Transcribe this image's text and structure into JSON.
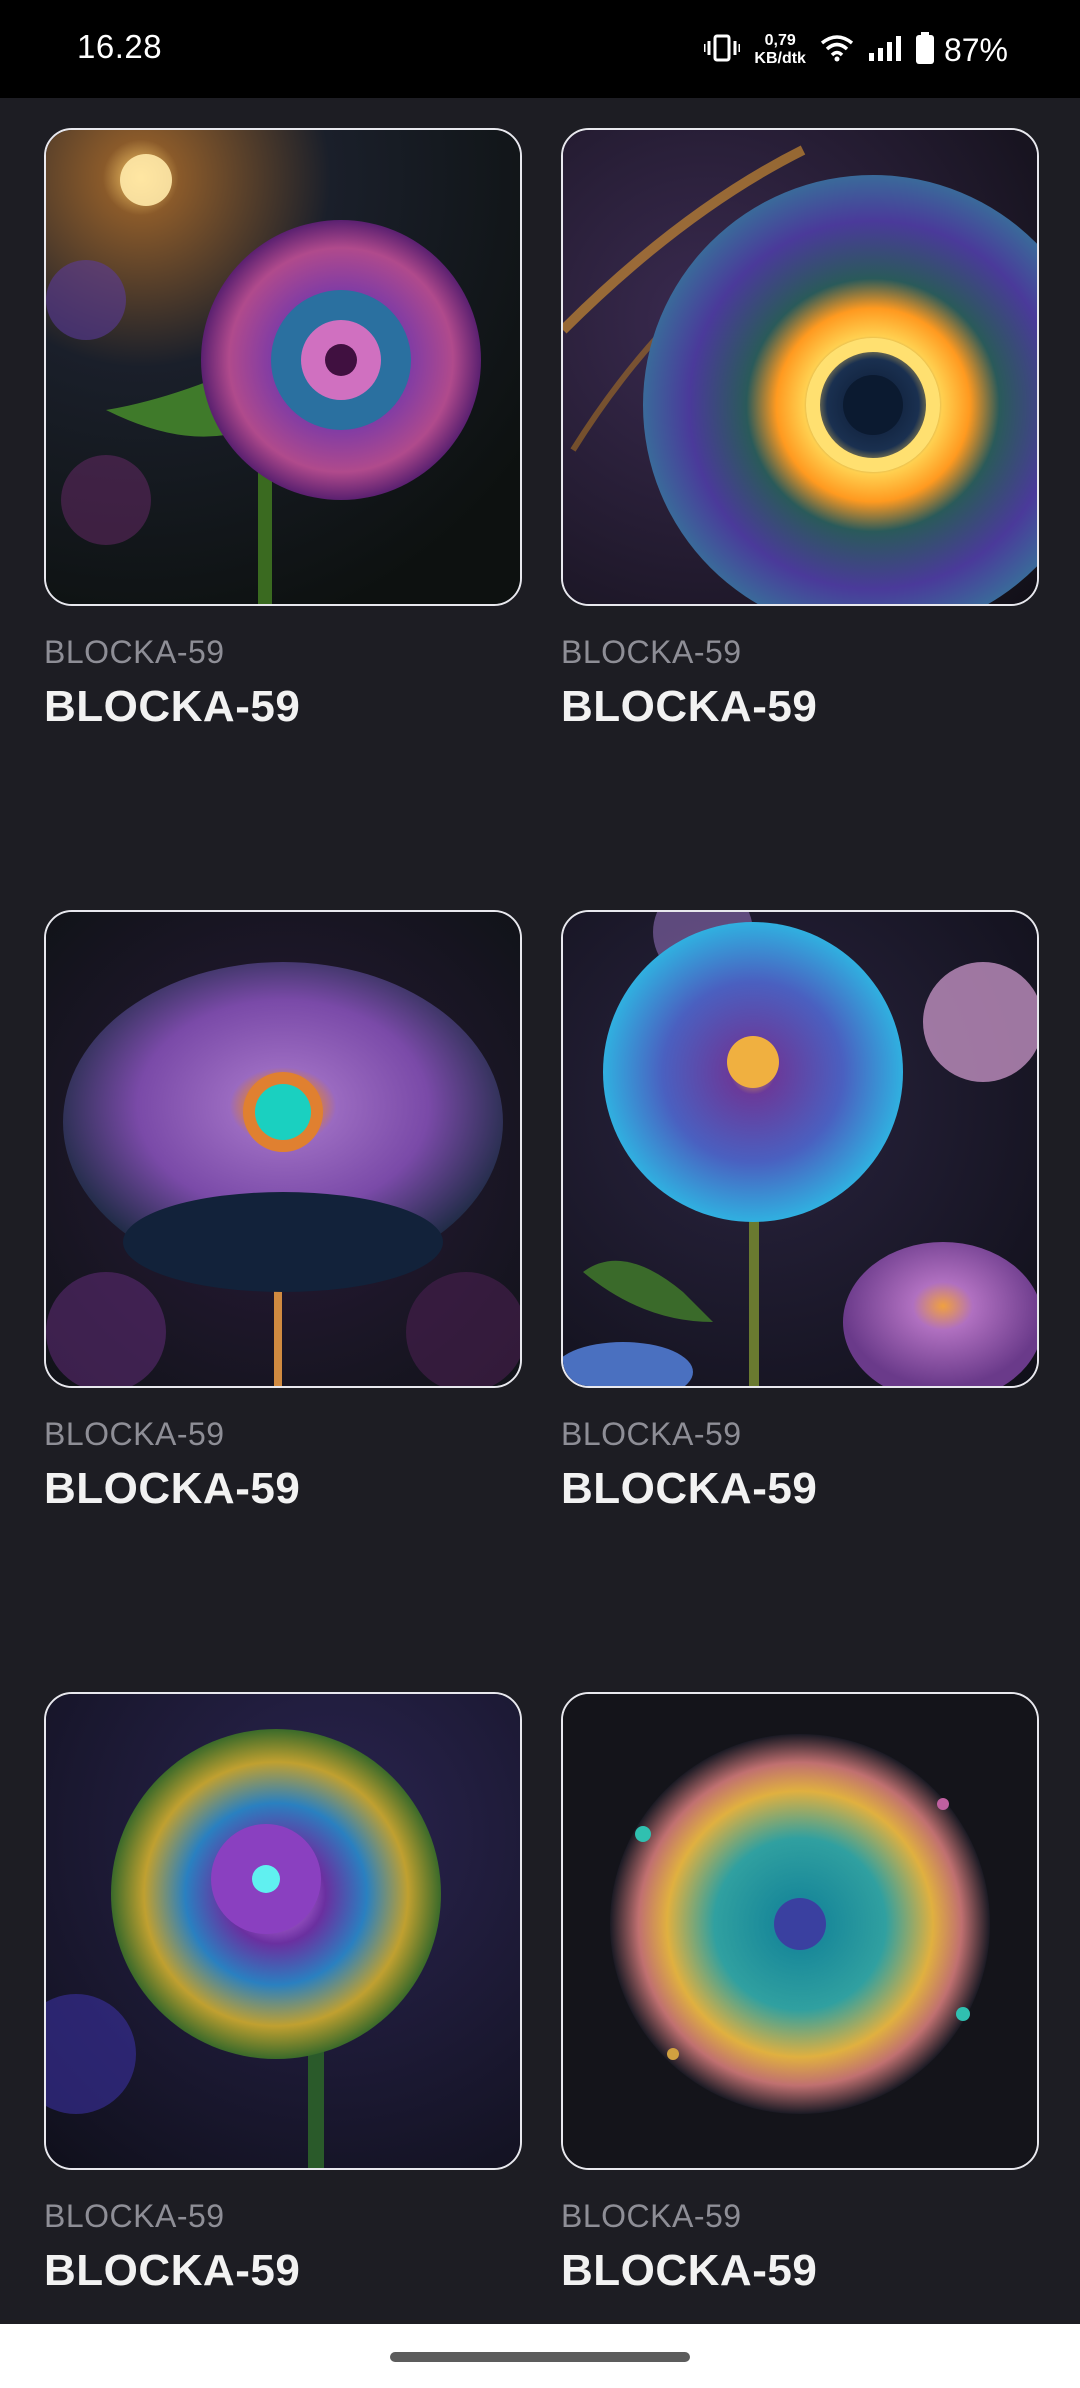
{
  "status_bar": {
    "time": "16.28",
    "net_speed_value": "0,79",
    "net_speed_unit": "KB/dtk",
    "battery": "87%"
  },
  "items": [
    {
      "subtitle": "BLOCKA-59",
      "title": "BLOCKA-59"
    },
    {
      "subtitle": "BLOCKA-59",
      "title": "BLOCKA-59"
    },
    {
      "subtitle": "BLOCKA-59",
      "title": "BLOCKA-59"
    },
    {
      "subtitle": "BLOCKA-59",
      "title": "BLOCKA-59"
    },
    {
      "subtitle": "BLOCKA-59",
      "title": "BLOCKA-59"
    },
    {
      "subtitle": "BLOCKA-59",
      "title": "BLOCKA-59"
    }
  ]
}
